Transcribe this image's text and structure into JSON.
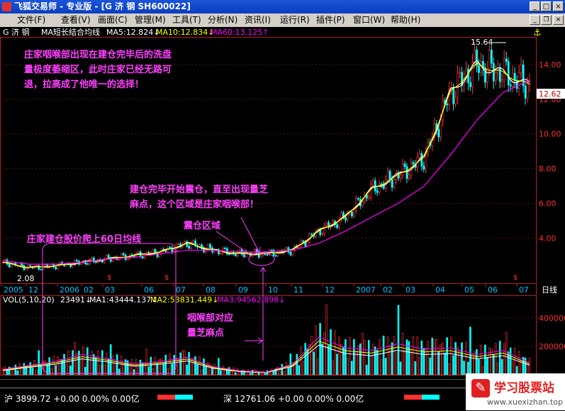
{
  "window": {
    "title": "飞狐交易师 - 专业版 - [G 济  钢 SH600022]",
    "controls": {
      "minimize": "_",
      "maximize": "□",
      "close": "×"
    }
  },
  "menu": [
    {
      "label": "文件(F)"
    },
    {
      "label": "查看(V)"
    },
    {
      "label": "画面(C)"
    },
    {
      "label": "管理(M)"
    },
    {
      "label": "工具(T)"
    },
    {
      "label": "分析(N)"
    },
    {
      "label": "资讯(I)"
    },
    {
      "label": "运行(R)"
    },
    {
      "label": "插件(P)"
    },
    {
      "label": "窗口(W)"
    },
    {
      "label": "帮助(H)"
    }
  ],
  "mdi_controls": {
    "minimize": "_",
    "restore": "❐",
    "close": "×"
  },
  "chart_header": {
    "stock": "G 济  钢",
    "indicator": "MA短长结合均线",
    "ma5": "MA5:12.824↓",
    "ma10": "MA10:12.834↓",
    "ma60": "MA60:13.125↑"
  },
  "volume_header": {
    "name": "VOL(5,10,20)",
    "vol": "23491↓",
    "ma1": "MA1:43444.137↓",
    "ma2": "MA2:53831.449↓",
    "ma3": "MA3:94562.898↓"
  },
  "price_labels": {
    "high": "15.64",
    "low": "2.08",
    "current": "12.62"
  },
  "annotations": [
    {
      "id": "note1",
      "lines": [
        "庄家咽喉部出现在建仓完毕后的洗盘",
        "量极度萎缩区，此时庄家已经无路可",
        "退，拉高成了他唯一的选择！"
      ]
    },
    {
      "id": "note2",
      "lines": [
        "建仓完毕开始震仓，直至出现量芝",
        "麻点，这个区域是庄家咽喉部！"
      ]
    },
    {
      "id": "note3",
      "lines": [
        "震仓区域"
      ]
    },
    {
      "id": "note4",
      "lines": [
        "庄家建仓股价爬上60日均线"
      ]
    },
    {
      "id": "note5",
      "lines": [
        "咽喉部对应",
        "量芝麻点"
      ]
    }
  ],
  "x_axis": [
    "2005",
    "12",
    "2006",
    "02",
    "03",
    "06",
    "07",
    "08",
    "09",
    "10",
    "11",
    "12",
    "2007",
    "02",
    "03",
    "04",
    "05",
    "06",
    "07"
  ],
  "period_label": "日线",
  "y_axis": [
    "14.00",
    "12.00",
    "10.00",
    "8.00",
    "6.00",
    "4.00"
  ],
  "vol_axis": [
    "400000",
    "200000"
  ],
  "status": [
    {
      "market": "沪",
      "value": "3899.72",
      "chg": "+0.00",
      "pct": "0.00%",
      "amt": "0.00亿"
    },
    {
      "market": "深",
      "value": "12761.06",
      "chg": "+0.00",
      "pct": "0.00%",
      "amt": "0.00亿"
    }
  ],
  "watermark": {
    "title": "学习股票站",
    "url": "www.xuexizhan.top"
  },
  "colors": {
    "up": "#ff3030",
    "down": "#00ffff",
    "ma5": "#ffffff",
    "ma10": "#ffff00",
    "ma60": "#ff00ff",
    "annotation": "#ff40ff"
  },
  "chart_data": {
    "type": "line",
    "title": "G 济  钢 SH600022",
    "price_range": [
      2.0,
      16.5
    ],
    "x": [
      "2005-11",
      "2005-12",
      "2006-01",
      "2006-02",
      "2006-03",
      "2006-04",
      "2006-05",
      "2006-06",
      "2006-07",
      "2006-08",
      "2006-09",
      "2006-10",
      "2006-11",
      "2006-12",
      "2007-01",
      "2007-02",
      "2007-03",
      "2007-04",
      "2007-05",
      "2007-06",
      "2007-07"
    ],
    "series": [
      {
        "name": "MA5",
        "values": [
          2.6,
          2.3,
          2.4,
          2.6,
          2.8,
          3.0,
          3.2,
          3.7,
          3.3,
          3.1,
          3.1,
          3.3,
          4.4,
          5.2,
          6.8,
          7.6,
          8.6,
          12.4,
          14.0,
          13.5,
          12.8
        ]
      },
      {
        "name": "MA60",
        "values": [
          2.7,
          2.5,
          2.5,
          2.6,
          2.8,
          2.9,
          3.1,
          3.3,
          3.3,
          3.2,
          3.2,
          3.3,
          3.7,
          4.4,
          5.2,
          6.0,
          7.0,
          8.8,
          10.8,
          12.4,
          13.1
        ]
      }
    ],
    "volume": {
      "ylim": [
        0,
        560000
      ],
      "ticks": [
        200000,
        400000
      ],
      "x": [
        "2005-11",
        "2005-12",
        "2006-01",
        "2006-02",
        "2006-03",
        "2006-04",
        "2006-05",
        "2006-06",
        "2006-07",
        "2006-08",
        "2006-09",
        "2006-10",
        "2006-11",
        "2006-12",
        "2007-01",
        "2007-02",
        "2007-03",
        "2007-04",
        "2007-05",
        "2007-06",
        "2007-07"
      ],
      "values": [
        40000,
        70000,
        100000,
        150000,
        120000,
        80000,
        100000,
        130000,
        60000,
        30000,
        20000,
        80000,
        280000,
        200000,
        180000,
        230000,
        190000,
        200000,
        150000,
        180000,
        90000
      ]
    }
  }
}
